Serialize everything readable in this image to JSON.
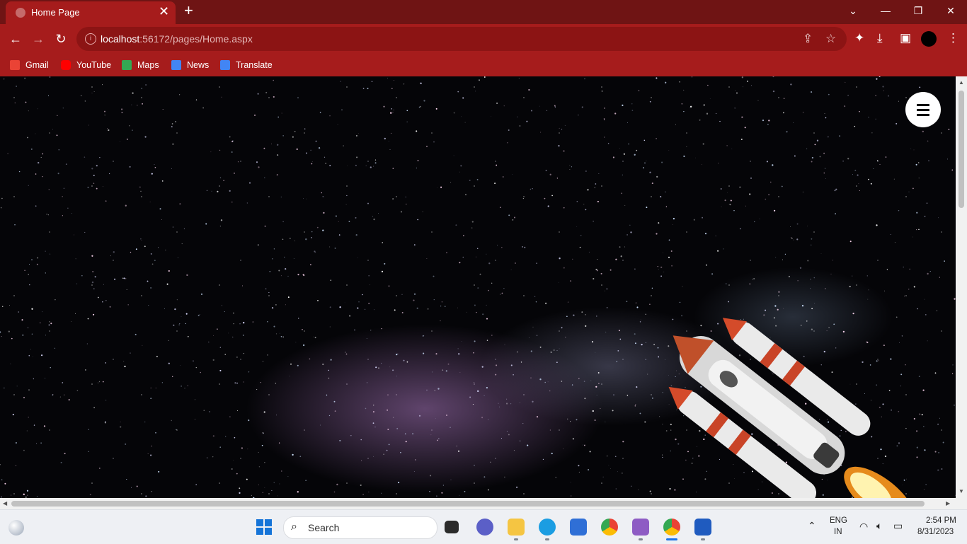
{
  "browser": {
    "tab_title": "Home Page",
    "url_host": "localhost",
    "url_rest": ":56172/pages/Home.aspx",
    "bookmarks": [
      {
        "label": "Gmail",
        "icon": "gmail-icon",
        "color": "#ea4335"
      },
      {
        "label": "YouTube",
        "icon": "youtube-icon",
        "color": "#ff0000"
      },
      {
        "label": "Maps",
        "icon": "maps-icon",
        "color": "#34a853"
      },
      {
        "label": "News",
        "icon": "news-icon",
        "color": "#4285f4"
      },
      {
        "label": "Translate",
        "icon": "translate-icon",
        "color": "#4285f4"
      }
    ],
    "theme_color": "#a61c1c"
  },
  "page": {
    "menu_icon": "hamburger-icon",
    "background": "starfield with rocket"
  },
  "taskbar": {
    "search_placeholder": "Search",
    "lang_line1": "ENG",
    "lang_line2": "IN",
    "time": "2:54 PM",
    "date": "8/31/2023"
  }
}
